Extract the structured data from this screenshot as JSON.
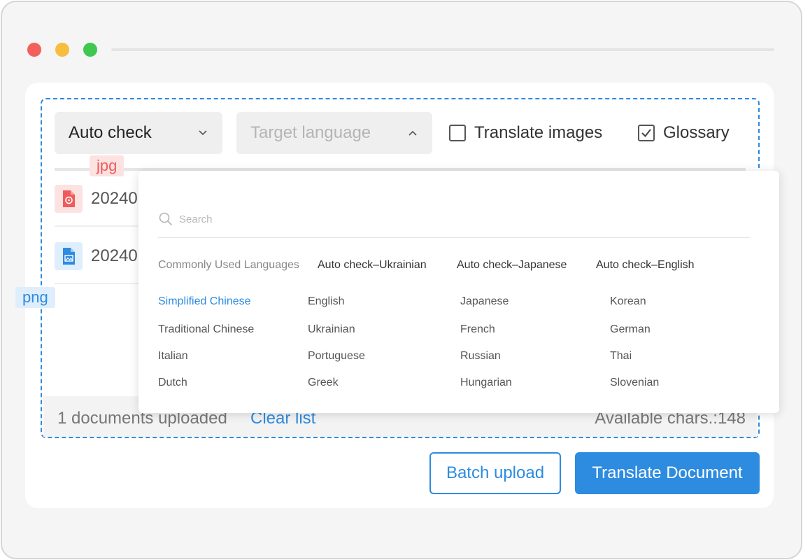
{
  "window": {
    "traffic_lights": {
      "close": "#f2605b",
      "minimize": "#f6bd3f",
      "maximize": "#3ec84f"
    }
  },
  "toolbar": {
    "source_language": "Auto check",
    "target_language_placeholder": "Target language",
    "translate_images": {
      "label": "Translate images",
      "checked": false
    },
    "glossary": {
      "label": "Glossary",
      "checked": true
    }
  },
  "tags": {
    "jpg": "jpg",
    "png": "png"
  },
  "files": [
    {
      "name": "20240",
      "type": "image-red"
    },
    {
      "name": "20240",
      "type": "image-blue"
    }
  ],
  "language_dropdown": {
    "search_placeholder": "Search",
    "common_label": "Commonly Used Languages",
    "common": [
      "Auto check–Ukrainian",
      "Auto check–Japanese",
      "Auto check–English"
    ],
    "languages": [
      [
        "Simplified Chinese",
        "English",
        "Japanese",
        "Korean"
      ],
      [
        "Traditional Chinese",
        "Ukrainian",
        "French",
        "German"
      ],
      [
        "Italian",
        "Portuguese",
        "Russian",
        "Thai"
      ],
      [
        "Dutch",
        "Greek",
        "Hungarian",
        "Slovenian"
      ]
    ],
    "selected": "Simplified Chinese"
  },
  "footer": {
    "documents_uploaded": "1 documents uploaded",
    "clear_list": "Clear list",
    "available_chars": "Available chars.:148"
  },
  "buttons": {
    "batch_upload": "Batch upload",
    "translate_document": "Translate Document"
  },
  "colors": {
    "accent": "#2d8be0",
    "jpg": "#ef5b5b"
  }
}
